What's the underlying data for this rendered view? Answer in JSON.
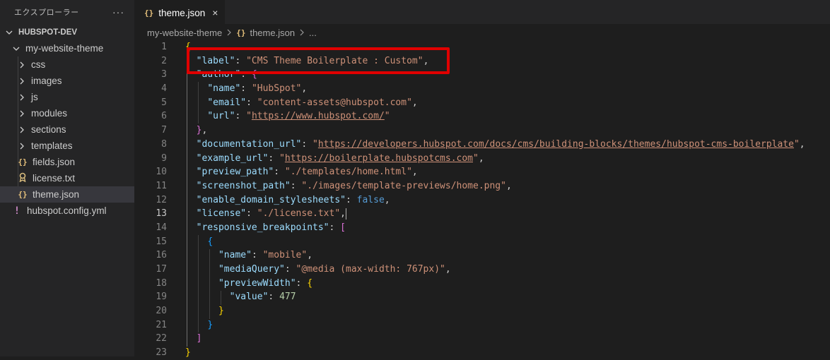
{
  "sidebar": {
    "title": "エクスプローラー",
    "more": "···",
    "root": "HUBSPOT-DEV",
    "folder": "my-website-theme",
    "items": [
      {
        "label": "css",
        "kind": "folder"
      },
      {
        "label": "images",
        "kind": "folder"
      },
      {
        "label": "js",
        "kind": "folder"
      },
      {
        "label": "modules",
        "kind": "folder"
      },
      {
        "label": "sections",
        "kind": "folder"
      },
      {
        "label": "templates",
        "kind": "folder"
      },
      {
        "label": "fields.json",
        "kind": "json"
      },
      {
        "label": "license.txt",
        "kind": "license"
      },
      {
        "label": "theme.json",
        "kind": "json",
        "selected": true
      }
    ],
    "root_file": "hubspot.config.yml"
  },
  "tab": {
    "label": "theme.json",
    "icon": "{}",
    "close": "×"
  },
  "breadcrumb": {
    "folder": "my-website-theme",
    "file": "theme.json",
    "more": "..."
  },
  "editor": {
    "active_line": 13,
    "line_numbers": [
      "1",
      "2",
      "3",
      "4",
      "5",
      "6",
      "7",
      "8",
      "9",
      "10",
      "11",
      "12",
      "13",
      "14",
      "15",
      "16",
      "17",
      "18",
      "19",
      "20",
      "21",
      "22",
      "23"
    ],
    "code": {
      "label_key": "\"label\"",
      "label_val": "\"CMS Theme Boilerplate : Custom\"",
      "author_key": "\"author\"",
      "name_key": "\"name\"",
      "name_val": "\"HubSpot\"",
      "email_key": "\"email\"",
      "email_val": "\"content-assets@hubspot.com\"",
      "url_key": "\"url\"",
      "url_val": "https://www.hubspot.com/",
      "doc_key": "\"documentation_url\"",
      "doc_val": "https://developers.hubspot.com/docs/cms/building-blocks/themes/hubspot-cms-boilerplate",
      "example_key": "\"example_url\"",
      "example_val": "https://boilerplate.hubspotcms.com",
      "preview_key": "\"preview_path\"",
      "preview_val": "\"./templates/home.html\"",
      "screenshot_key": "\"screenshot_path\"",
      "screenshot_val": "\"./images/template-previews/home.png\"",
      "domain_key": "\"enable_domain_stylesheets\"",
      "domain_val": "false",
      "license_key": "\"license\"",
      "license_val": "\"./license.txt\"",
      "bp_key": "\"responsive_breakpoints\"",
      "bp_name_key": "\"name\"",
      "bp_name_val": "\"mobile\"",
      "mq_key": "\"mediaQuery\"",
      "mq_val": "\"@media (max-width: 767px)\"",
      "pw_key": "\"previewWidth\"",
      "value_key": "\"value\"",
      "value_val": "477"
    }
  },
  "colors": {
    "highlight_box": "#e00000",
    "json_key": "#9cdcfe",
    "json_string": "#ce9178"
  }
}
